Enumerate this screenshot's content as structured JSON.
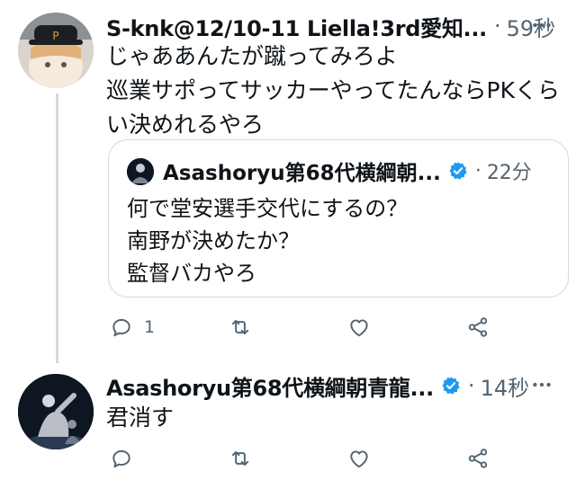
{
  "tweet1": {
    "author": "S-knk@12/10-11 Liella!3rd愛知...",
    "time": "59秒",
    "text_line1": "じゃああんたが蹴ってみろよ",
    "text_line2": "巡業サポってサッカーやってたんならPKくら",
    "text_line3": "い決めれるやろ",
    "quote": {
      "author": "Asashoryu第68代横綱朝...",
      "time": "22分",
      "line1": "何で堂安選手交代にするの？",
      "line2": "南野が決めたか？",
      "line3": "監督バカやろ"
    },
    "reply_count": "1"
  },
  "tweet2": {
    "author": "Asashoryu第68代横綱朝青龍...",
    "time": "14秒",
    "text": "君消す"
  },
  "separator": "·",
  "icons": {
    "reply": "reply-icon",
    "retweet": "retweet-icon",
    "like": "heart-icon",
    "share": "share-icon",
    "more": "more-options-icon",
    "verified": "verified-badge-icon"
  },
  "colors": {
    "text": "#0f1419",
    "secondary": "#536471",
    "verified": "#1d9bf0",
    "border": "#cfd9de"
  }
}
